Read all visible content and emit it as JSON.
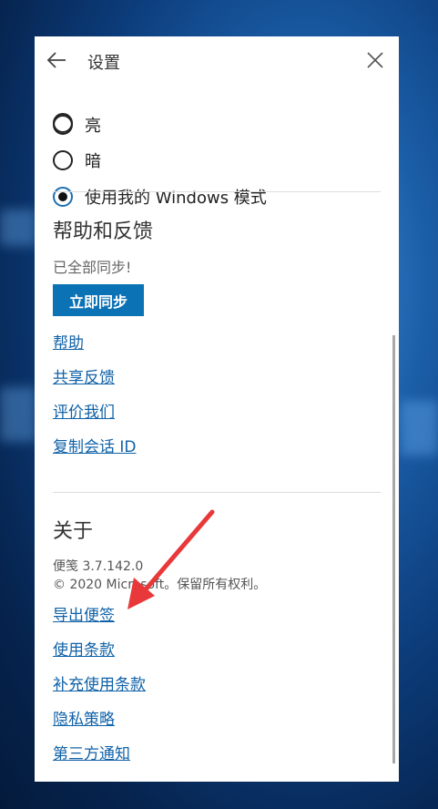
{
  "window": {
    "title": "设置"
  },
  "theme_options": [
    {
      "label": "亮",
      "selected": false
    },
    {
      "label": "暗",
      "selected": false
    },
    {
      "label": "使用我的 Windows 模式",
      "selected": true
    }
  ],
  "help": {
    "heading": "帮助和反馈",
    "sync_status": "已全部同步!",
    "sync_button": "立即同步",
    "links": [
      "帮助",
      "共享反馈",
      "评价我们",
      "复制会话 ID"
    ]
  },
  "about": {
    "heading": "关于",
    "version": "便笺 3.7.142.0",
    "copyright": "© 2020 Microsoft。保留所有权利。",
    "links": [
      "导出便签",
      "使用条款",
      "补充使用条款",
      "隐私策略",
      "第三方通知"
    ]
  },
  "colors": {
    "accent": "#0c72b6",
    "link": "#1062a8",
    "annotation_arrow": "#e8383a"
  },
  "icons": {
    "back": "back-arrow-icon",
    "close": "close-icon"
  }
}
